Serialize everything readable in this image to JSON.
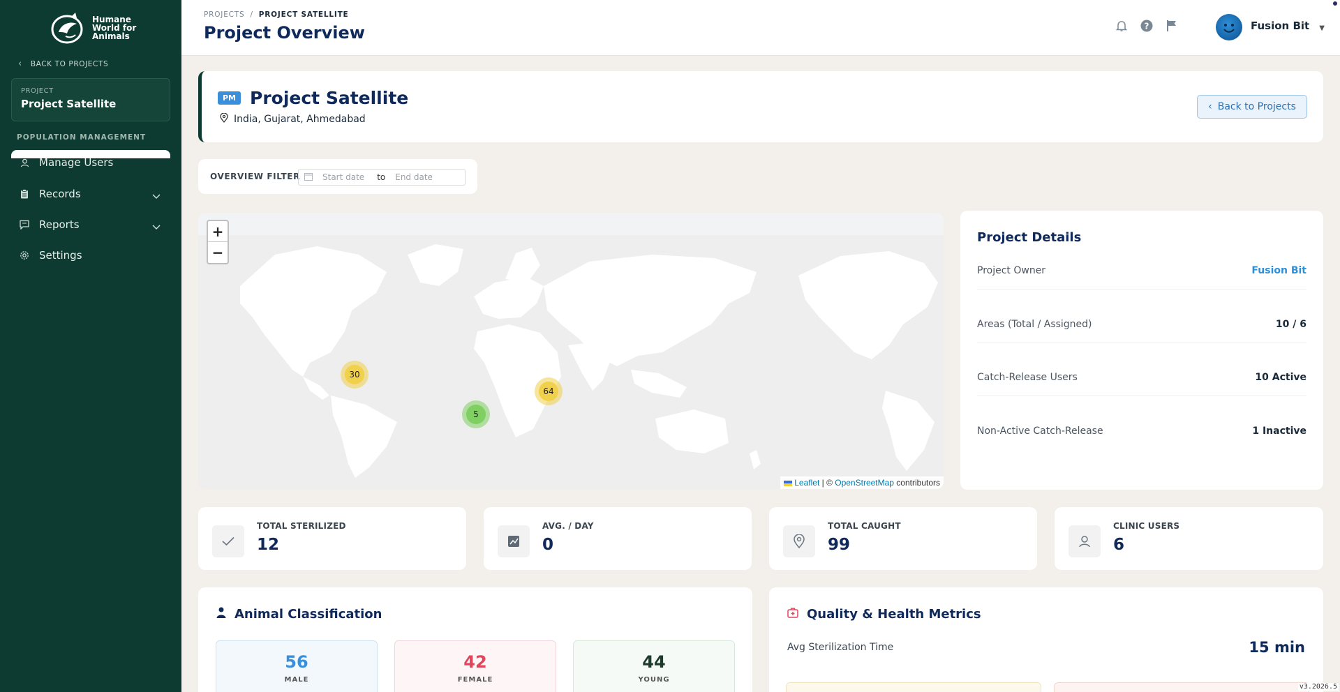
{
  "sidebar": {
    "logo_text": "Humane World for Animals",
    "back_label": "BACK TO PROJECTS",
    "project_label": "PROJECT",
    "project_name": "Project Satellite",
    "section_label": "POPULATION MANAGEMENT",
    "items": [
      {
        "label": "Manage Users",
        "icon": "user-icon"
      },
      {
        "label": "Records",
        "icon": "clipboard-icon"
      },
      {
        "label": "Reports",
        "icon": "chat-icon"
      },
      {
        "label": "Settings",
        "icon": "gear-icon"
      }
    ]
  },
  "header": {
    "breadcrumb": [
      "PROJECTS",
      "PROJECT SATELLITE"
    ],
    "title": "Project Overview",
    "user_name": "Fusion Bit"
  },
  "project": {
    "badge": "PM",
    "name": "Project Satellite",
    "location": "India, Gujarat, Ahmedabad",
    "back_button": "Back to Projects"
  },
  "filter": {
    "label": "OVERVIEW FILTER",
    "start_placeholder": "Start date",
    "to_label": "to",
    "end_placeholder": "End date"
  },
  "map": {
    "zoom_in": "+",
    "zoom_out": "−",
    "clusters": [
      {
        "count": "30",
        "color": "#f1d04b"
      },
      {
        "count": "5",
        "color": "#7fcf62"
      },
      {
        "count": "64",
        "color": "#f1d04b"
      }
    ],
    "attribution": {
      "leaflet": "Leaflet",
      "sep": " | © ",
      "osm": "OpenStreetMap",
      "rest": " contributors"
    }
  },
  "details": {
    "title": "Project Details",
    "rows": [
      {
        "key": "Project Owner",
        "value": "Fusion Bit"
      },
      {
        "key": "Areas (Total / Assigned)",
        "value": "10 / 6"
      },
      {
        "key": "Catch-Release Users",
        "value": "10 Active"
      },
      {
        "key": "Non-Active Catch-Release",
        "value": "1 Inactive"
      }
    ]
  },
  "stats": [
    {
      "label": "TOTAL STERILIZED",
      "value": "12",
      "icon": "check-icon"
    },
    {
      "label": "AVG. / DAY",
      "value": "0",
      "icon": "chart-icon"
    },
    {
      "label": "TOTAL CAUGHT",
      "value": "99",
      "icon": "pin-icon"
    },
    {
      "label": "CLINIC USERS",
      "value": "6",
      "icon": "user-icon"
    }
  ],
  "classification": {
    "title": "Animal Classification",
    "boxes": [
      {
        "value": "56",
        "label": "MALE",
        "color": "#3a8fdb"
      },
      {
        "value": "42",
        "label": "FEMALE",
        "color": "#e0455b"
      },
      {
        "value": "44",
        "label": "YOUNG",
        "color": "#1e3a2a"
      }
    ]
  },
  "quality": {
    "title": "Quality & Health Metrics",
    "metric_label": "Avg Sterilization Time",
    "metric_value": "15 min"
  },
  "version": "v3.2026.5"
}
